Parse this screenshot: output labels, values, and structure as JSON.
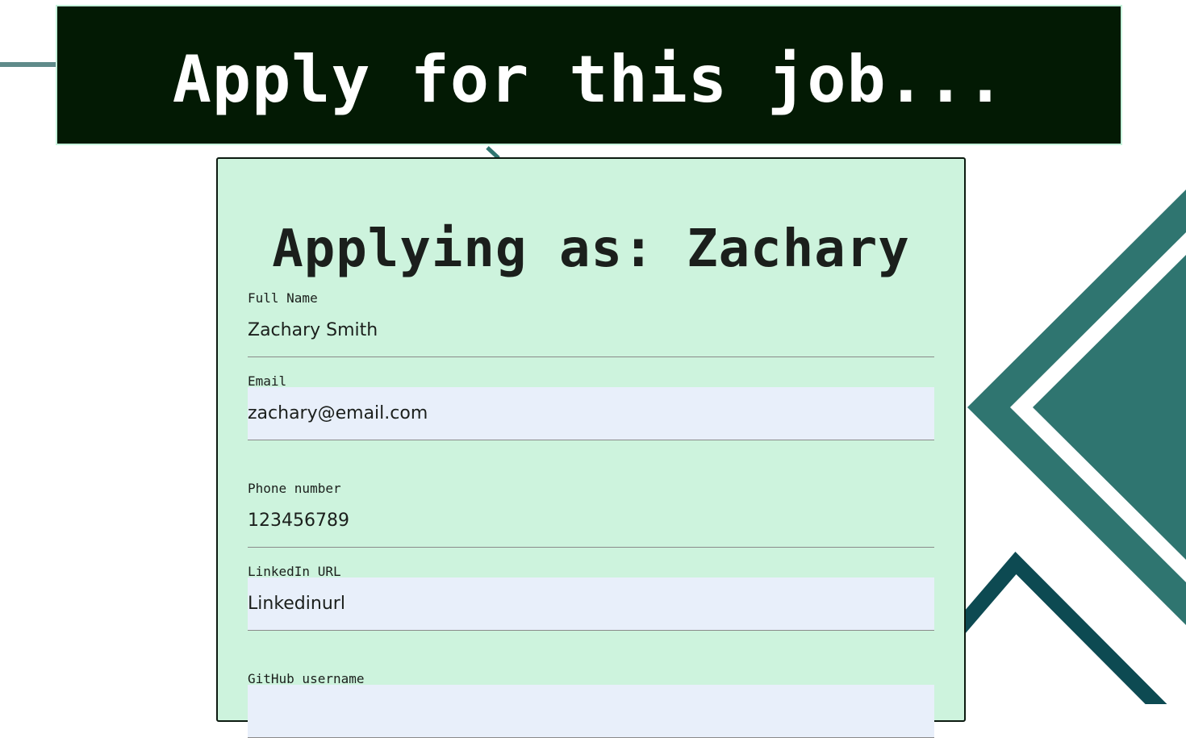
{
  "header": {
    "title": "Apply for this job..."
  },
  "form": {
    "heading": "Applying as: Zachary",
    "fields": [
      {
        "label": "Full Name",
        "value": "Zachary Smith",
        "autofilled": false
      },
      {
        "label": "Email",
        "value": "zachary@email.com",
        "autofilled": true
      },
      {
        "label": "Phone number",
        "value": "123456789",
        "autofilled": false
      },
      {
        "label": "LinkedIn URL",
        "value": "Linkedinurl",
        "autofilled": true
      },
      {
        "label": "GitHub username",
        "value": "",
        "autofilled": true
      }
    ]
  },
  "colors": {
    "header_bg": "#031a04",
    "card_bg": "#cdf3dd",
    "autofill_bg": "#e8effa",
    "deco_teal": "#2f7570",
    "deco_dark": "#0d4a52"
  }
}
